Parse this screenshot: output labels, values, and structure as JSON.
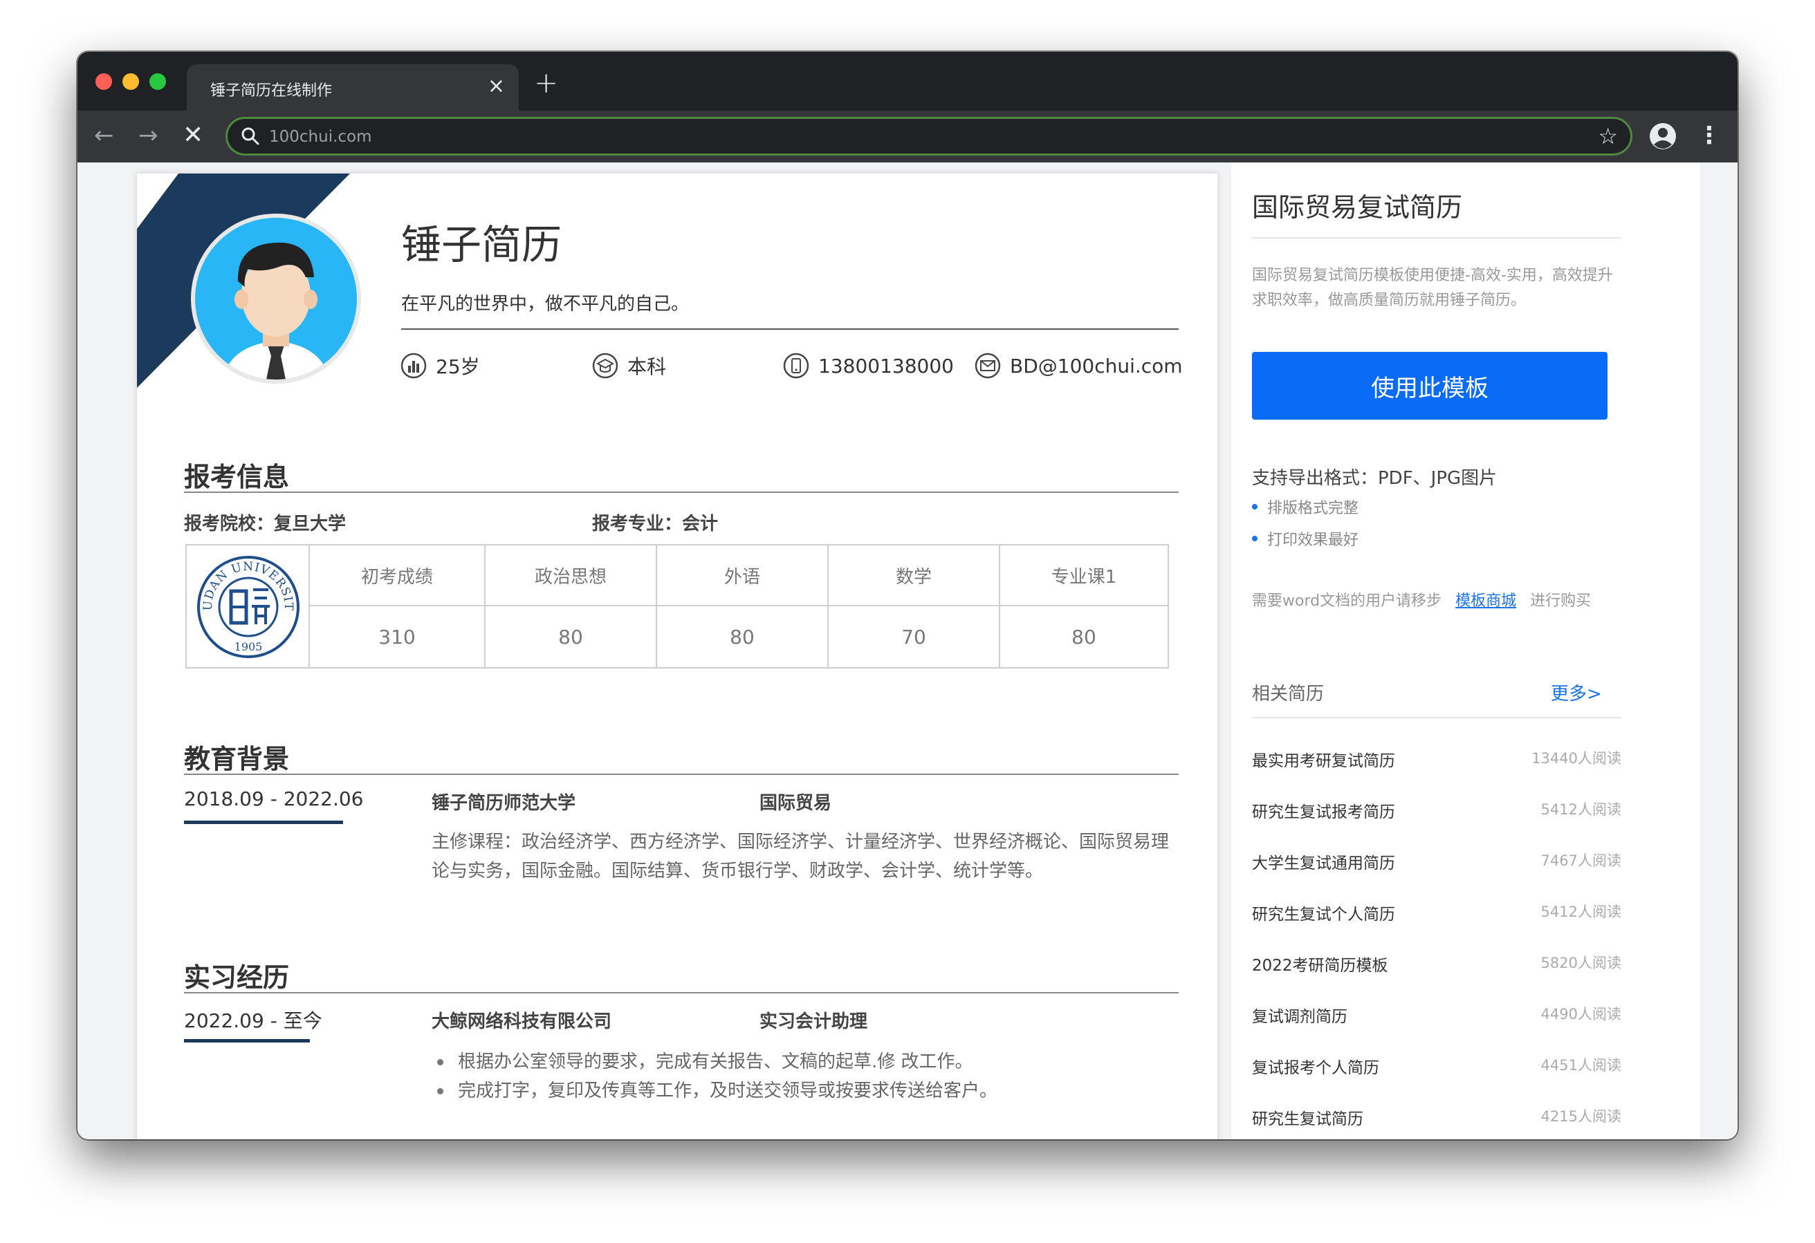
{
  "browser": {
    "tab_title": "锤子简历在线制作",
    "tab_close": "×",
    "new_tab": "+",
    "url": "100chui.com",
    "back": "←",
    "forward": "→",
    "stop": "✕",
    "star": "☆",
    "menu": "⋮"
  },
  "resume": {
    "name": "锤子简历",
    "motto": "在平凡的世界中，做不平凡的自己。",
    "info": [
      {
        "icon": "chart-icon",
        "text": "25岁"
      },
      {
        "icon": "education-icon",
        "text": "本科"
      },
      {
        "icon": "phone-icon",
        "text": "13800138000"
      },
      {
        "icon": "mail-icon",
        "text": "BD@100chui.com"
      }
    ],
    "exam": {
      "title": "报考信息",
      "school": "报考院校：复旦大学",
      "major": "报考专业：会计",
      "seal_text_top": "FUDAN UNIVERSITY",
      "seal_year": "1905",
      "scores": [
        {
          "label": "初考成绩",
          "value": "310"
        },
        {
          "label": "政治思想",
          "value": "80"
        },
        {
          "label": "外语",
          "value": "80"
        },
        {
          "label": "数学",
          "value": "70"
        },
        {
          "label": "专业课1",
          "value": "80"
        }
      ]
    },
    "education": {
      "title": "教育背景",
      "date": "2018.09 - 2022.06",
      "school": "锤子简历师范大学",
      "major": "国际贸易",
      "courses": "主修课程：政治经济学、西方经济学、国际经济学、计量经济学、世界经济概论、国际贸易理论与实务，国际金融。国际结算、货币银行学、财政学、会计学、统计学等。"
    },
    "internship": {
      "title": "实习经历",
      "date": "2022.09 - 至今",
      "company": "大鲸网络科技有限公司",
      "role": "实习会计助理",
      "bullets": [
        "根据办公室领导的要求，完成有关报告、文稿的起草.修 改工作。",
        "完成打字，复印及传真等工作，及时送交领导或按要求传送给客户。"
      ]
    }
  },
  "sidebar": {
    "title": "国际贸易复试简历",
    "description": "国际贸易复试简历模板使用便捷-高效-实用，高效提升求职效率，做高质量简历就用锤子简历。",
    "use_button": "使用此模板",
    "formats": "支持导出格式：PDF、JPG图片",
    "features": [
      "排版格式完整",
      "打印效果最好"
    ],
    "word_prefix": "需要word文档的用户请移步",
    "word_link": "模板商城",
    "word_suffix": "进行购买",
    "related_title": "相关简历",
    "more": "更多>",
    "related": [
      {
        "title": "最实用考研复试简历",
        "count": "13440人阅读"
      },
      {
        "title": "研究生复试报考简历",
        "count": "5412人阅读"
      },
      {
        "title": "大学生复试通用简历",
        "count": "7467人阅读"
      },
      {
        "title": "研究生复试个人简历",
        "count": "5412人阅读"
      },
      {
        "title": "2022考研简历模板",
        "count": "5820人阅读"
      },
      {
        "title": "复试调剂简历",
        "count": "4490人阅读"
      },
      {
        "title": "复试报考个人简历",
        "count": "4451人阅读"
      },
      {
        "title": "研究生复试简历",
        "count": "4215人阅读"
      }
    ]
  },
  "colors": {
    "accent_navy": "#1c3a5c",
    "button_blue": "#0a6cf5",
    "link_blue": "#1a73e8",
    "avatar_bg": "#29b6f6"
  }
}
